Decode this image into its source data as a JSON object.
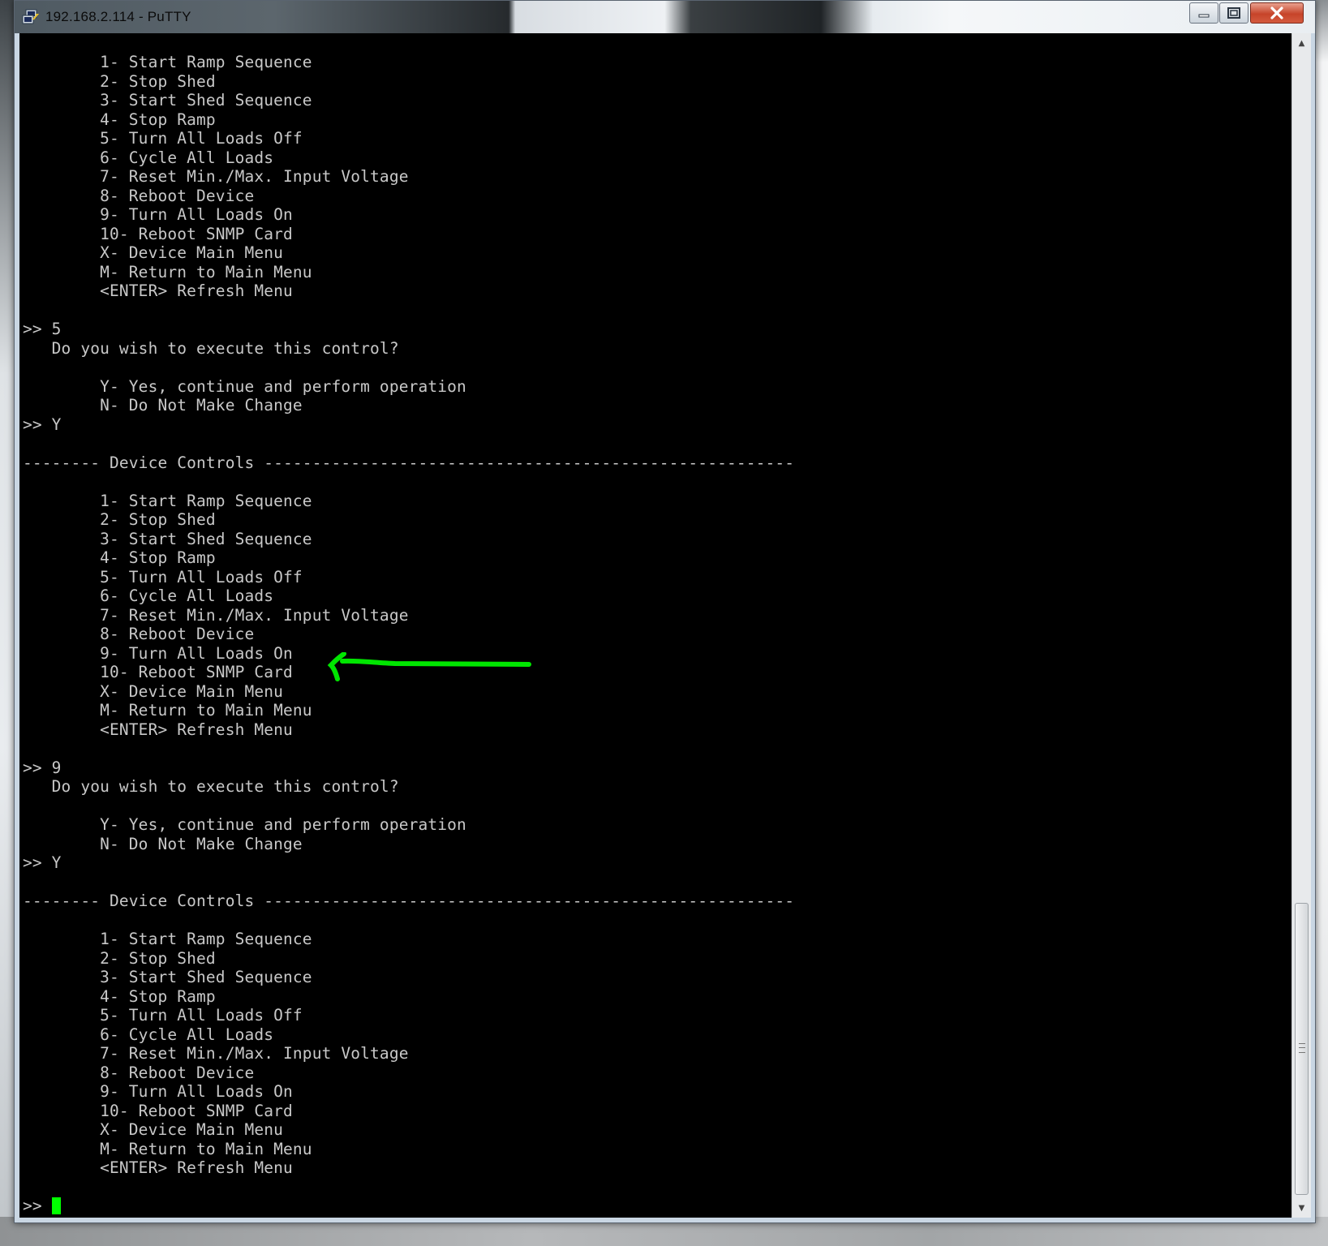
{
  "window": {
    "title": "192.168.2.114 - PuTTY",
    "controls": {
      "minimize": "minimize",
      "maximize": "maximize",
      "close": "close"
    }
  },
  "colors": {
    "terminal_bg": "#000000",
    "terminal_fg": "#c8c8c8",
    "cursor": "#00ff00",
    "annotation_arrow": "#00e600"
  },
  "terminal": {
    "lines": [
      "        1- Start Ramp Sequence",
      "        2- Stop Shed",
      "        3- Start Shed Sequence",
      "        4- Stop Ramp",
      "        5- Turn All Loads Off",
      "        6- Cycle All Loads",
      "        7- Reset Min./Max. Input Voltage",
      "        8- Reboot Device",
      "        9- Turn All Loads On",
      "        10- Reboot SNMP Card",
      "        X- Device Main Menu",
      "        M- Return to Main Menu",
      "        <ENTER> Refresh Menu",
      "",
      ">> 5",
      "   Do you wish to execute this control?",
      "",
      "        Y- Yes, continue and perform operation",
      "        N- Do Not Make Change",
      ">> Y",
      "",
      "-------- Device Controls -------------------------------------------------------",
      "",
      "        1- Start Ramp Sequence",
      "        2- Stop Shed",
      "        3- Start Shed Sequence",
      "        4- Stop Ramp",
      "        5- Turn All Loads Off",
      "        6- Cycle All Loads",
      "        7- Reset Min./Max. Input Voltage",
      "        8- Reboot Device",
      "        9- Turn All Loads On",
      "        10- Reboot SNMP Card",
      "        X- Device Main Menu",
      "        M- Return to Main Menu",
      "        <ENTER> Refresh Menu",
      "",
      ">> 9",
      "   Do you wish to execute this control?",
      "",
      "        Y- Yes, continue and perform operation",
      "        N- Do Not Make Change",
      ">> Y",
      "",
      "-------- Device Controls -------------------------------------------------------",
      "",
      "        1- Start Ramp Sequence",
      "        2- Stop Shed",
      "        3- Start Shed Sequence",
      "        4- Stop Ramp",
      "        5- Turn All Loads Off",
      "        6- Cycle All Loads",
      "        7- Reset Min./Max. Input Voltage",
      "        8- Reboot Device",
      "        9- Turn All Loads On",
      "        10- Reboot SNMP Card",
      "        X- Device Main Menu",
      "        M- Return to Main Menu",
      "        <ENTER> Refresh Menu",
      ""
    ],
    "prompt": ">> "
  },
  "icons": {
    "app": "putty-icon",
    "annotation": "arrow-left-icon",
    "scroll_up": "scroll-up-icon",
    "scroll_down": "scroll-down-icon"
  }
}
